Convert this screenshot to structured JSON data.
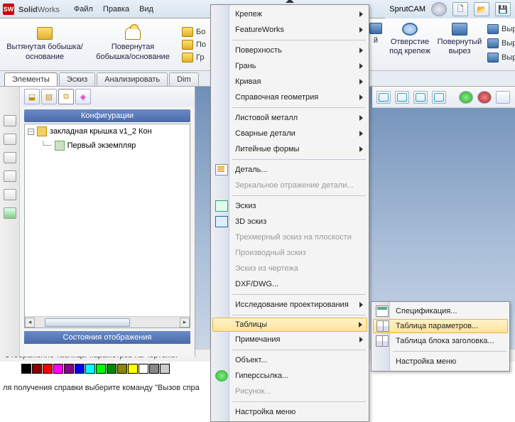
{
  "app": {
    "name_a": "Solid",
    "name_b": "Works"
  },
  "menubar": {
    "file": "Файл",
    "edit": "Правка",
    "view": "Вид"
  },
  "right_title": {
    "sprutcam": "SprutCAM"
  },
  "bigtoolbar": {
    "extrude": "Вытянутая бобышка/основание",
    "revolve": "Повернутая бобышка/основание",
    "small1": "Бо",
    "small2": "По",
    "small3": "Гр"
  },
  "right_big": {
    "hole": "Отверстие под крепеж",
    "revcut": "Повернутый вырез",
    "s1": "Вырез п",
    "s2": "Вырез п",
    "s3": "Вырез г",
    "short_i": "й"
  },
  "tabs": {
    "t1": "Элементы",
    "t2": "Эскиз",
    "t3": "Анализировать",
    "t4": "Dim"
  },
  "left": {
    "cfg_header": "Конфигурации",
    "root": "закладная крышка v1_2 Кон",
    "child": "Первый экземпляр",
    "state_header": "Состояния отображения"
  },
  "status": "Отображение таблицы параметров на чертеже.",
  "palette": [
    "#000",
    "#800",
    "#f00",
    "#f0f",
    "#808",
    "#00f",
    "#0ff",
    "#0f0",
    "#080",
    "#880",
    "#ff0",
    "#fff",
    "#888",
    "#ccc"
  ],
  "bottom_hint": "ля получения справки выберите команду \"Вызов спра",
  "menu1": {
    "fasteners": "Крепеж",
    "featureworks": "FeatureWorks",
    "surface": "Поверхность",
    "face": "Грань",
    "curve": "Кривая",
    "refgeom": "Справочная геометрия",
    "sheetmetal": "Листовой металл",
    "weldments": "Сварные детали",
    "mold": "Литейные формы",
    "part": "Деталь...",
    "mirror": "Зеркальное отражение детали...",
    "sketch": "Эскиз",
    "sketch3d": "3D эскиз",
    "sketch3dplane": "Трехмерный эскиз на плоскости",
    "derived": "Производный эскиз",
    "fromdwg": "Эскиз из чертежа",
    "dxf": "DXF/DWG...",
    "design_study": "Исследование проектирования",
    "tables": "Таблицы",
    "annotations": "Примечания",
    "object": "Объект...",
    "hyperlink": "Гиперссылка...",
    "picture": "Рисунок...",
    "customize": "Настройка меню"
  },
  "menu2": {
    "spec": "Спецификация...",
    "paramtable": "Таблица параметров...",
    "titleblock": "Таблица блока заголовка...",
    "customize": "Настройка меню"
  }
}
